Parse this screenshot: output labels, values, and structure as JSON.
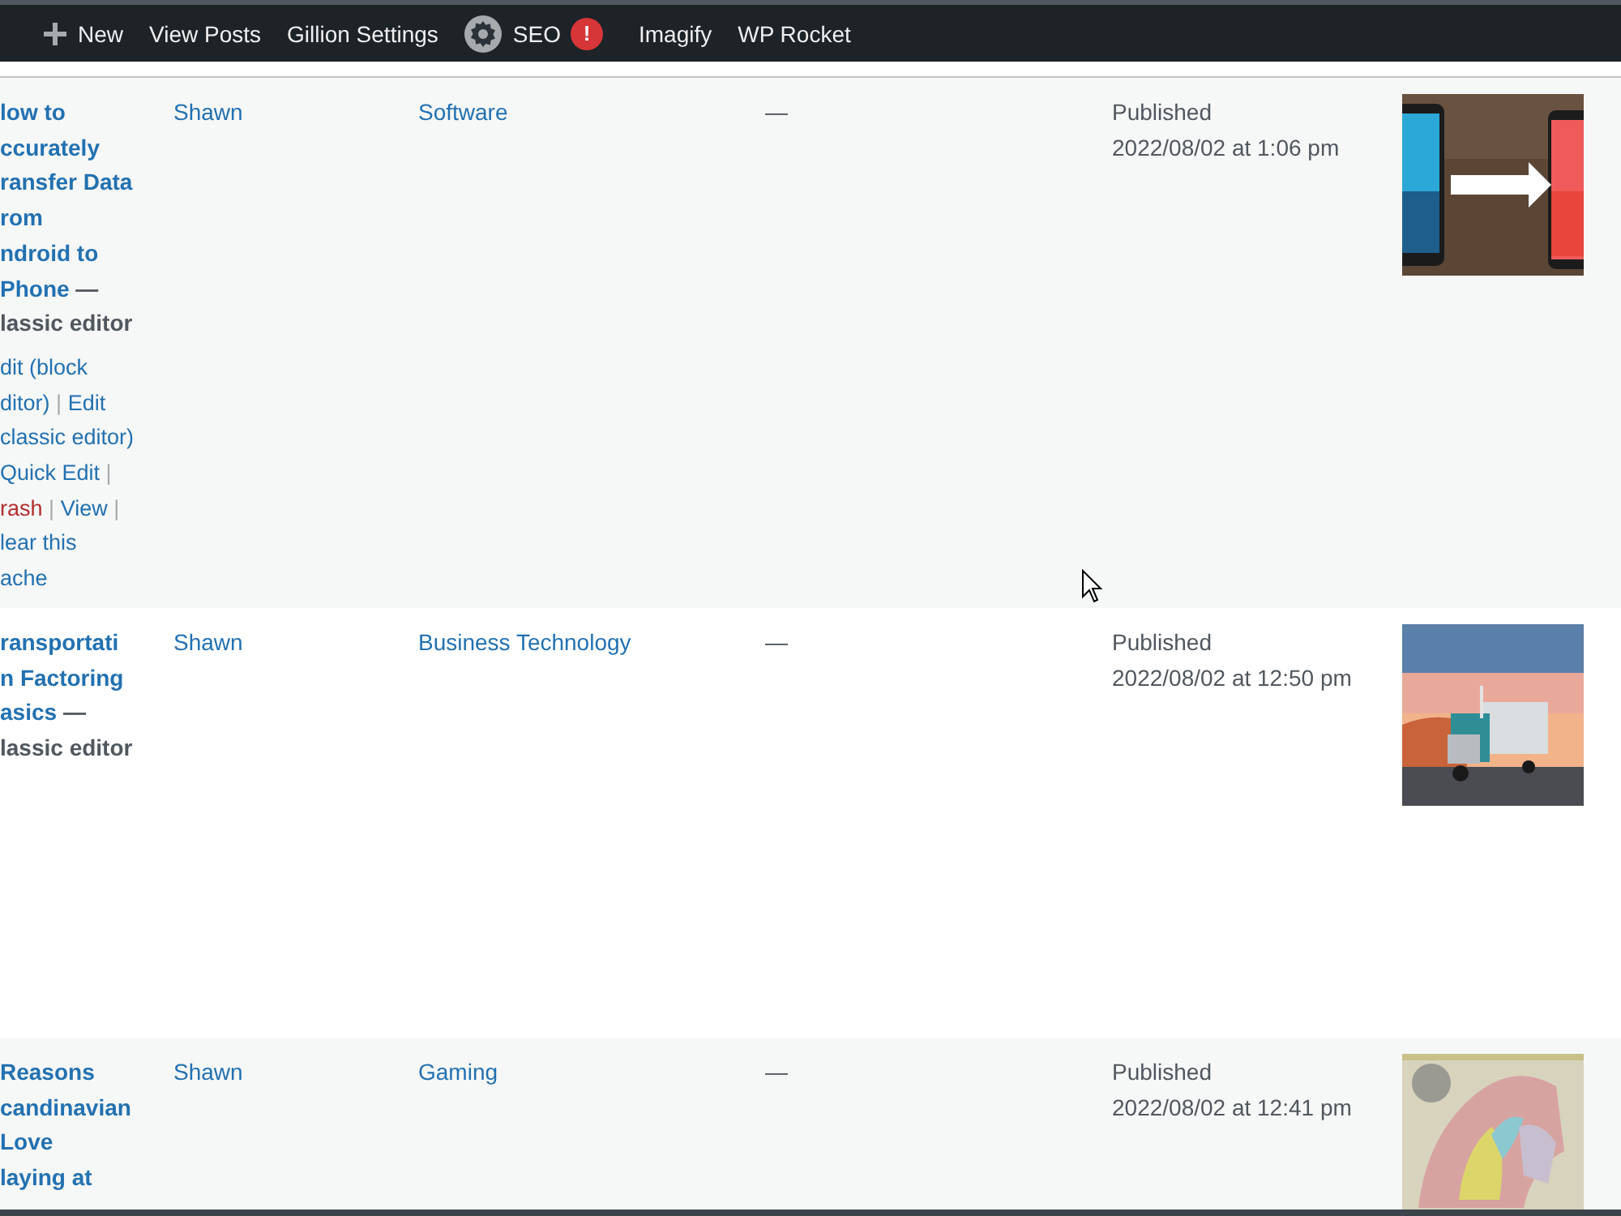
{
  "admin_bar": {
    "items": [
      {
        "kind": "new",
        "label": "New"
      },
      {
        "kind": "link",
        "label": "View Posts"
      },
      {
        "kind": "link",
        "label": "Gillion Settings"
      },
      {
        "kind": "seo",
        "label": "SEO",
        "badge": "!"
      },
      {
        "kind": "link",
        "label": "Imagify"
      },
      {
        "kind": "link",
        "label": "WP Rocket"
      }
    ]
  },
  "posts": [
    {
      "title_lines": [
        [
          {
            "kind": "title",
            "text": "low to"
          }
        ],
        [
          {
            "kind": "title",
            "text": "ccurately"
          }
        ],
        [
          {
            "kind": "title",
            "text": "ransfer Data"
          }
        ],
        [
          {
            "kind": "title",
            "text": "rom"
          }
        ],
        [
          {
            "kind": "title",
            "text": "ndroid to"
          }
        ],
        [
          {
            "kind": "title",
            "text": "Phone"
          },
          {
            "kind": "state",
            "text": "—"
          }
        ],
        [
          {
            "kind": "state",
            "text": "lassic editor"
          }
        ]
      ],
      "row_actions": [
        [
          {
            "kind": "link",
            "label": "dit (block"
          }
        ],
        [
          {
            "kind": "link",
            "label": "ditor)"
          },
          {
            "kind": "separator",
            "label": "|"
          },
          {
            "kind": "link",
            "label": "Edit"
          }
        ],
        [
          {
            "kind": "link",
            "label": "classic editor)"
          }
        ],
        [
          {
            "kind": "link",
            "label": "Quick Edit"
          },
          {
            "kind": "separator",
            "label": "|"
          }
        ],
        [
          {
            "kind": "trash",
            "label": "rash"
          },
          {
            "kind": "separator",
            "label": "|"
          },
          {
            "kind": "link",
            "label": "View"
          },
          {
            "kind": "separator",
            "label": "|"
          }
        ],
        [
          {
            "kind": "link",
            "label": "lear this"
          }
        ],
        [
          {
            "kind": "link",
            "label": "ache"
          }
        ]
      ],
      "author": "Shawn",
      "category": "Software",
      "tags": "—",
      "status": "Published",
      "date": "2022/08/02 at 1:06 pm",
      "thumbnail": {
        "kind": "picture"
      }
    },
    {
      "title_lines": [
        [
          {
            "kind": "title",
            "text": "ransportati"
          }
        ],
        [
          {
            "kind": "title",
            "text": "n Factoring"
          }
        ],
        [
          {
            "kind": "title",
            "text": "asics"
          },
          {
            "kind": "state",
            "text": "—"
          }
        ],
        [
          {
            "kind": "state",
            "text": "lassic editor"
          }
        ]
      ],
      "author": "Shawn",
      "category": "Business Technology",
      "tags": "—",
      "status": "Published",
      "date": "2022/08/02 at 12:50 pm",
      "thumbnail": {
        "kind": "picture"
      }
    },
    {
      "title_lines": [
        [
          {
            "kind": "title",
            "text": "Reasons"
          }
        ],
        [
          {
            "kind": "title",
            "text": "candinavian"
          }
        ],
        [
          {
            "kind": "title",
            "text": "Love"
          }
        ],
        [
          {
            "kind": "title",
            "text": "laying at"
          }
        ]
      ],
      "author": "Shawn",
      "category": "Gaming",
      "tags": "—",
      "status": "Published",
      "date": "2022/08/02 at 12:41 pm",
      "thumbnail": {
        "kind": "picture"
      }
    }
  ]
}
